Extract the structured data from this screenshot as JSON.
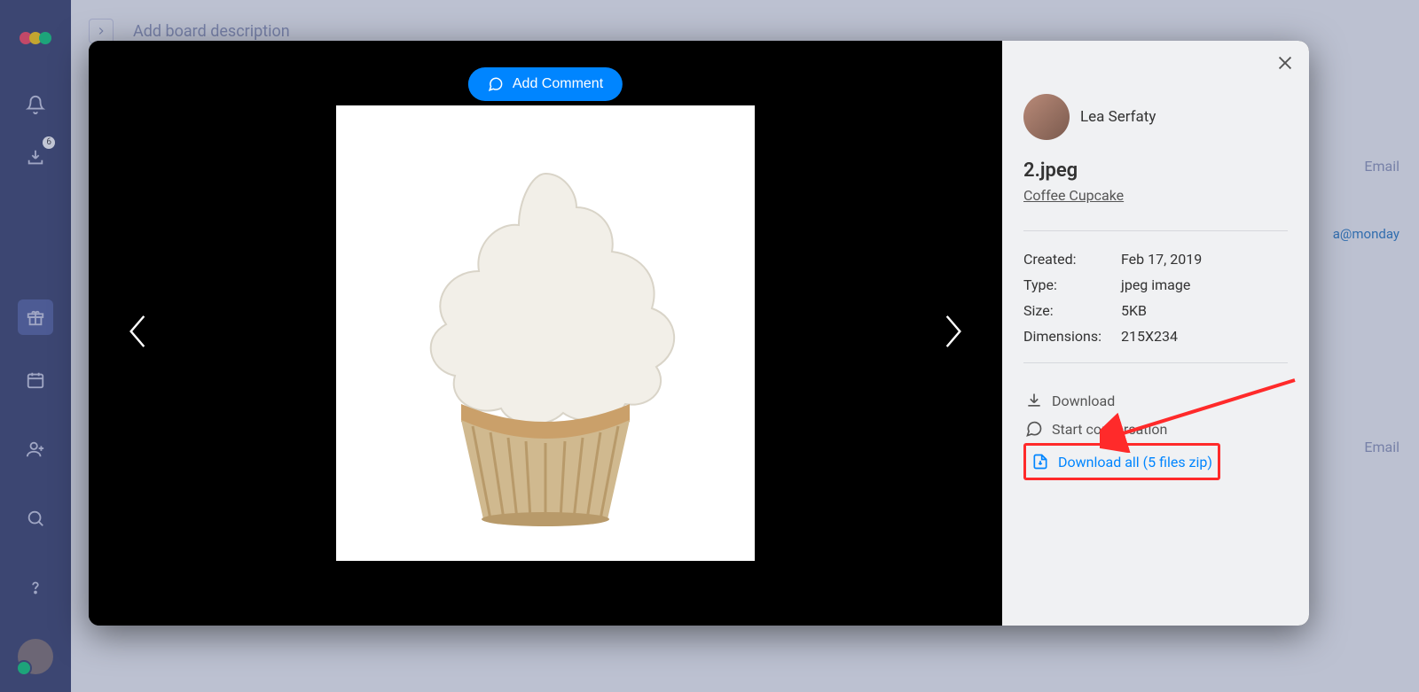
{
  "leftbar": {
    "inbox_badge": "6"
  },
  "board": {
    "description_placeholder": "Add board description",
    "right_label_1": "Email",
    "right_label_2": "Email",
    "partial_email": "a@monday"
  },
  "lightbox": {
    "add_comment_label": "Add Comment",
    "uploader_name": "Lea Serfaty",
    "file_name": "2.jpeg",
    "file_subtitle": "Coffee Cupcake",
    "meta": {
      "created_label": "Created:",
      "created_value": "Feb 17, 2019",
      "type_label": "Type:",
      "type_value": "jpeg image",
      "size_label": "Size:",
      "size_value": "5KB",
      "dim_label": "Dimensions:",
      "dim_value": "215X234"
    },
    "actions": {
      "download": "Download",
      "start_conversation": "Start conversation",
      "download_all": "Download all (5 files zip)"
    }
  }
}
